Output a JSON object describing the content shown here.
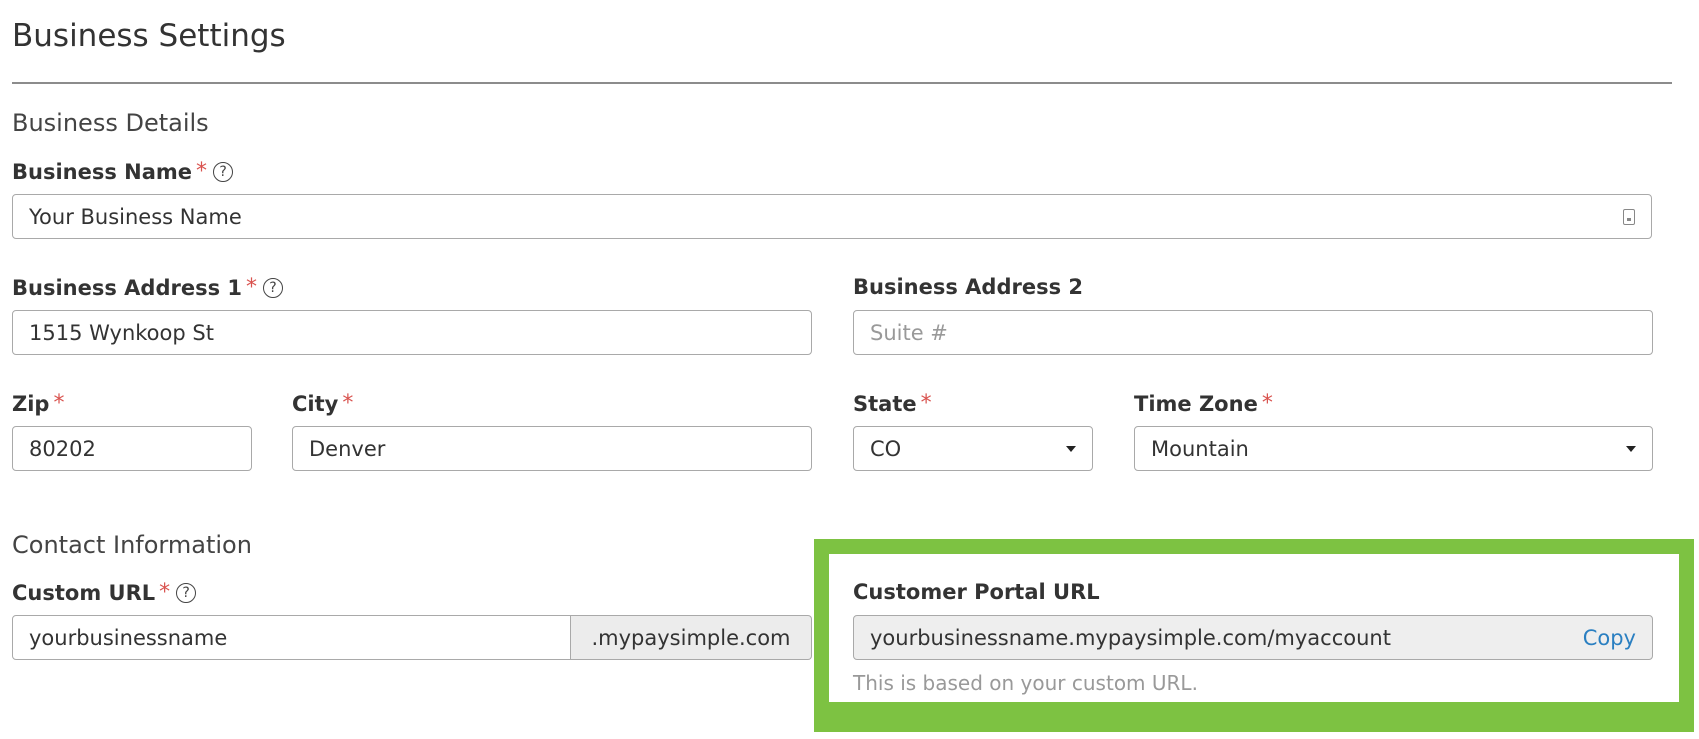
{
  "page": {
    "title": "Business Settings"
  },
  "business_details": {
    "heading": "Business Details",
    "business_name": {
      "label": "Business Name",
      "value": "Your Business Name",
      "required": "*",
      "help": "?"
    },
    "address1": {
      "label": "Business Address 1",
      "value": "1515 Wynkoop St",
      "required": "*",
      "help": "?"
    },
    "address2": {
      "label": "Business Address 2",
      "placeholder": "Suite #"
    },
    "zip": {
      "label": "Zip",
      "value": "80202",
      "required": "*"
    },
    "city": {
      "label": "City",
      "value": "Denver",
      "required": "*"
    },
    "state": {
      "label": "State",
      "value": "CO",
      "required": "*"
    },
    "time_zone": {
      "label": "Time Zone",
      "value": "Mountain",
      "required": "*"
    }
  },
  "contact_information": {
    "heading": "Contact Information",
    "custom_url": {
      "label": "Custom URL",
      "value": "yourbusinessname",
      "suffix": ".mypaysimple.com",
      "required": "*",
      "help": "?"
    },
    "customer_portal_url": {
      "label": "Customer Portal URL",
      "value": "yourbusinessname.mypaysimple.com/myaccount",
      "copy_label": "Copy",
      "hint": "This is based on your custom URL."
    }
  },
  "colors": {
    "highlight": "#7dc242",
    "required": "#d9534f",
    "link": "#2a7fc1"
  }
}
